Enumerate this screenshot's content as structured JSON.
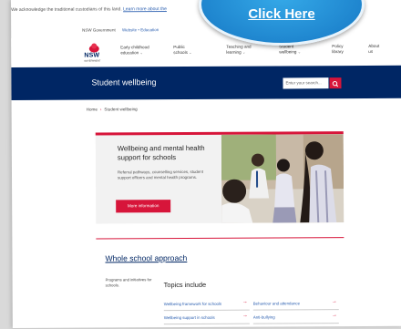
{
  "ack_banner": {
    "text": "We acknowledge the traditional custodians of this land. ",
    "link": "Learn more about the"
  },
  "gov_bar": {
    "text": "NSW Government",
    "link": "Website • Education"
  },
  "logo": {
    "wordmark": "NSW",
    "subtitle": "GOVERNMENT"
  },
  "nav": [
    {
      "line1": "Early childhood",
      "line2": "education"
    },
    {
      "line1": "Public",
      "line2": "schools"
    },
    {
      "line1": "Teaching and",
      "line2": "learning"
    },
    {
      "line1": "Student",
      "line2": "wellbeing"
    },
    {
      "line1": "Policy",
      "line2": "library"
    },
    {
      "line1": "About",
      "line2": "us"
    }
  ],
  "hero": {
    "title": "Student wellbeing",
    "search_placeholder": "Enter your search..."
  },
  "breadcrumb": [
    "Home",
    "Student wellbeing"
  ],
  "card": {
    "title": "Wellbeing and mental health support for schools",
    "body": "Referral pathways, counselling services, student support officers and mental health programs.",
    "button": "More information"
  },
  "whole_school": {
    "title": "Whole school approach",
    "intro": "Programs and initiatives for schools.",
    "topics_heading": "Topics include",
    "topics": [
      "Wellbeing framework for schools",
      "Behaviour and attendance",
      "Wellbeing support in schools",
      "Anti-bullying"
    ]
  },
  "badge": {
    "cta": "Click Here"
  },
  "colors": {
    "navy": "#002664",
    "red": "#d7153a",
    "badge_blue": "#1f86cf"
  }
}
